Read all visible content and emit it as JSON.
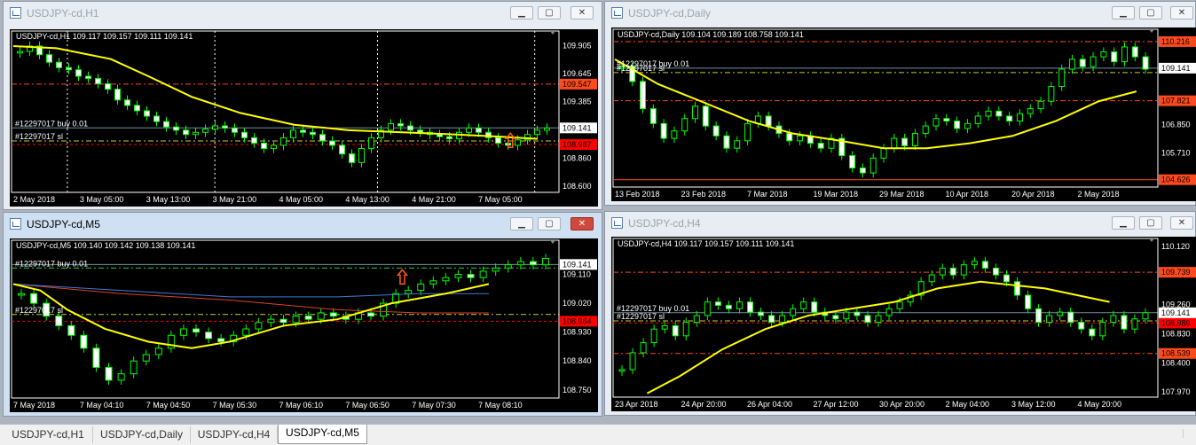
{
  "windows": [
    {
      "id": "h1",
      "active": false,
      "title": "USDJPY-cd,H1",
      "ohlc": "USDJPY-cd,H1  109.117 109.157 109.111 109.141",
      "price_min": 108.56,
      "price_max": 109.99,
      "price_labels": [
        "109.905",
        "109.645",
        "109.385",
        "109.141",
        "108.860",
        "108.600"
      ],
      "bid_label": "109.141",
      "bid": 109.141,
      "level_tags": [
        {
          "text": "109.547",
          "value": 109.547,
          "color": "#ff4a1c"
        },
        {
          "text": "108.987",
          "value": 108.987,
          "color": "#ff0000"
        }
      ],
      "hlines": [
        {
          "value": 109.547,
          "color": "#ff4a1c",
          "dash": "6,3,2,3"
        },
        {
          "value": 109.141,
          "color": "#6d8fa0",
          "dash": ""
        },
        {
          "value": 109.02,
          "color": "#cccc33",
          "dash": "6,3,2,3"
        },
        {
          "value": 108.987,
          "color": "#ff0000",
          "dash": "3,3"
        }
      ],
      "order_labels": [
        {
          "text": "#12297017 buy 0.01",
          "value": 109.141
        },
        {
          "text": "#12297017 sl",
          "value": 109.02
        }
      ],
      "time_labels": [
        "2 May 2018",
        "3 May 05:00",
        "3 May 13:00",
        "3 May 21:00",
        "4 May 05:00",
        "4 May 13:00",
        "4 May 21:00",
        "7 May 05:00"
      ],
      "day_separators": [
        0.1,
        0.373,
        0.674,
        0.965
      ],
      "arrow_index": 0.92,
      "ma": [
        [
          0,
          109.9
        ],
        [
          0.08,
          109.88
        ],
        [
          0.18,
          109.78
        ],
        [
          0.25,
          109.62
        ],
        [
          0.33,
          109.43
        ],
        [
          0.42,
          109.28
        ],
        [
          0.52,
          109.17
        ],
        [
          0.62,
          109.12
        ],
        [
          0.72,
          109.1
        ],
        [
          0.82,
          109.08
        ],
        [
          0.9,
          109.06
        ],
        [
          0.97,
          109.04
        ]
      ],
      "close_path": [
        109.85,
        109.9,
        109.82,
        109.75,
        109.7,
        109.68,
        109.62,
        109.6,
        109.55,
        109.5,
        109.4,
        109.35,
        109.3,
        109.25,
        109.2,
        109.15,
        109.12,
        109.08,
        109.1,
        109.13,
        109.16,
        109.14,
        109.1,
        109.05,
        109.0,
        108.95,
        108.98,
        109.05,
        109.12,
        109.1,
        109.08,
        109.02,
        108.98,
        108.9,
        108.82,
        108.95,
        109.05,
        109.12,
        109.18,
        109.16,
        109.12,
        109.1,
        109.08,
        109.06,
        109.04,
        109.1,
        109.14,
        109.1,
        109.05,
        109.0,
        108.98,
        109.03,
        109.08,
        109.12,
        109.14
      ]
    },
    {
      "id": "daily",
      "active": false,
      "title": "USDJPY-cd,Daily",
      "ohlc": "USDJPY-cd,Daily  109.104 109.189 108.758 109.141",
      "price_min": 104.4,
      "price_max": 110.5,
      "price_labels": [
        "110.216",
        "109.141",
        "107.821",
        "106.850",
        "105.710",
        "104.626"
      ],
      "bid_label": "109.141",
      "bid": 109.141,
      "level_tags": [
        {
          "text": "110.216",
          "value": 110.216,
          "color": "#ff4a1c"
        },
        {
          "text": "107.821",
          "value": 107.821,
          "color": "#ff4a1c"
        },
        {
          "text": "104.626",
          "value": 104.626,
          "color": "#ff4a1c"
        }
      ],
      "hlines": [
        {
          "value": 110.216,
          "color": "#ff4a1c",
          "dash": "6,3,2,3"
        },
        {
          "value": 109.141,
          "color": "#6d8fa0",
          "dash": ""
        },
        {
          "value": 108.96,
          "color": "#cccc33",
          "dash": "6,3,2,3"
        },
        {
          "value": 107.821,
          "color": "#ff4a1c",
          "dash": "6,3,2,3"
        },
        {
          "value": 104.626,
          "color": "#ff4a1c",
          "dash": ""
        }
      ],
      "order_labels": [
        {
          "text": "#12297017 buy 0.01",
          "value": 109.141
        },
        {
          "text": "#12297017 sl",
          "value": 108.96
        }
      ],
      "time_labels": [
        "13 Feb 2018",
        "23 Feb 2018",
        "7 Mar 2018",
        "19 Mar 2018",
        "29 Mar 2018",
        "10 Apr 2018",
        "20 Apr 2018",
        "2 May 2018"
      ],
      "day_separators": [],
      "arrow_index": -1,
      "ma": [
        [
          0,
          109.5
        ],
        [
          0.08,
          108.5
        ],
        [
          0.16,
          107.8
        ],
        [
          0.25,
          107.0
        ],
        [
          0.33,
          106.5
        ],
        [
          0.42,
          106.2
        ],
        [
          0.5,
          105.9
        ],
        [
          0.58,
          105.9
        ],
        [
          0.66,
          106.1
        ],
        [
          0.74,
          106.4
        ],
        [
          0.82,
          107.0
        ],
        [
          0.9,
          107.8
        ],
        [
          0.97,
          108.2
        ]
      ],
      "close_path": [
        109.2,
        108.6,
        107.5,
        106.9,
        106.3,
        106.6,
        107.1,
        107.6,
        106.8,
        106.4,
        105.9,
        106.2,
        106.9,
        107.2,
        106.8,
        106.5,
        106.2,
        106.4,
        106.1,
        105.9,
        106.3,
        105.6,
        105.1,
        104.9,
        105.5,
        105.9,
        106.3,
        106.0,
        106.5,
        106.8,
        107.1,
        107.0,
        106.7,
        106.9,
        107.2,
        107.4,
        107.2,
        107.0,
        107.3,
        107.5,
        107.8,
        108.4,
        109.1,
        109.5,
        109.2,
        109.6,
        109.8,
        109.4,
        110.0,
        109.6,
        109.1
      ]
    },
    {
      "id": "m5",
      "active": true,
      "title": "USDJPY-cd,M5",
      "ohlc": "USDJPY-cd,M5  109.140 109.142 109.138 109.141",
      "price_min": 108.73,
      "price_max": 109.2,
      "price_labels": [
        "109.141",
        "109.110",
        "109.020",
        "108.930",
        "108.840",
        "108.750"
      ],
      "bid_label": "109.141",
      "bid": 109.141,
      "level_tags": [
        {
          "text": "108.964",
          "value": 108.964,
          "color": "#ff0000"
        }
      ],
      "hlines": [
        {
          "value": 109.141,
          "color": "#6d8fa0",
          "dash": ""
        },
        {
          "value": 109.13,
          "color": "#33cc33",
          "dash": "6,3,2,3"
        },
        {
          "value": 108.985,
          "color": "#cccc33",
          "dash": "6,3,2,3"
        },
        {
          "value": 108.964,
          "color": "#ff0000",
          "dash": "3,3"
        }
      ],
      "order_labels": [
        {
          "text": "#12297017 buy 0.01",
          "value": 109.13
        },
        {
          "text": "#12297017 sl",
          "value": 108.985
        }
      ],
      "time_labels": [
        "7 May 2018",
        "7 May 04:10",
        "7 May 04:50",
        "7 May 05:30",
        "7 May 06:10",
        "7 May 06:50",
        "7 May 07:30",
        "7 May 08:10"
      ],
      "day_separators": [],
      "arrow_index": 0.72,
      "ma": [
        [
          0,
          109.08
        ],
        [
          0.05,
          109.06
        ],
        [
          0.1,
          109.0
        ],
        [
          0.17,
          108.94
        ],
        [
          0.25,
          108.9
        ],
        [
          0.33,
          108.88
        ],
        [
          0.4,
          108.9
        ],
        [
          0.5,
          108.95
        ],
        [
          0.6,
          108.97
        ],
        [
          0.7,
          109.02
        ],
        [
          0.8,
          109.05
        ],
        [
          0.88,
          109.08
        ]
      ],
      "ma2": [
        [
          0,
          109.08
        ],
        [
          0.2,
          109.06
        ],
        [
          0.4,
          109.04
        ],
        [
          0.6,
          109.04
        ],
        [
          0.75,
          109.05
        ],
        [
          0.88,
          109.05
        ]
      ],
      "ma3": [
        [
          0,
          109.08
        ],
        [
          0.2,
          109.05
        ],
        [
          0.4,
          109.03
        ],
        [
          0.6,
          109.0
        ],
        [
          0.75,
          108.99
        ],
        [
          0.88,
          108.99
        ]
      ],
      "close_path": [
        109.05,
        109.02,
        108.98,
        108.95,
        108.92,
        108.88,
        108.82,
        108.78,
        108.8,
        108.84,
        108.86,
        108.88,
        108.92,
        108.94,
        108.93,
        108.91,
        108.9,
        108.92,
        108.94,
        108.96,
        108.97,
        108.96,
        108.98,
        108.97,
        108.99,
        108.98,
        108.97,
        108.99,
        108.98,
        109.02,
        109.05,
        109.06,
        109.08,
        109.09,
        109.1,
        109.11,
        109.1,
        109.12,
        109.13,
        109.14,
        109.15,
        109.14,
        109.16
      ]
    },
    {
      "id": "h4",
      "active": false,
      "title": "USDJPY-cd,H4",
      "ohlc": "USDJPY-cd,H4  109.117 109.157 109.111 109.141",
      "price_min": 107.92,
      "price_max": 110.16,
      "price_labels": [
        "110.120",
        "109.739",
        "109.260",
        "109.141",
        "108.989",
        "108.830",
        "108.539",
        "108.400",
        "107.970"
      ],
      "bid_label": "109.141",
      "bid": 109.141,
      "level_tags": [
        {
          "text": "109.739",
          "value": 109.739,
          "color": "#ff4a1c"
        },
        {
          "text": "108.989",
          "value": 108.989,
          "color": "#ff0000"
        },
        {
          "text": "108.539",
          "value": 108.539,
          "color": "#ff4a1c"
        }
      ],
      "hlines": [
        {
          "value": 109.739,
          "color": "#ff4a1c",
          "dash": "6,3,2,3"
        },
        {
          "value": 109.141,
          "color": "#6d8fa0",
          "dash": ""
        },
        {
          "value": 109.02,
          "color": "#cccc33",
          "dash": "6,3,2,3"
        },
        {
          "value": 108.989,
          "color": "#ff0000",
          "dash": "3,3"
        },
        {
          "value": 108.539,
          "color": "#ff4a1c",
          "dash": "6,3,2,3"
        }
      ],
      "order_labels": [
        {
          "text": "#12297017 buy 0.01",
          "value": 109.141
        },
        {
          "text": "#12297017 sl",
          "value": 109.02
        }
      ],
      "time_labels": [
        "23 Apr 2018",
        "24 Apr 20:00",
        "26 Apr 04:00",
        "27 Apr 12:00",
        "30 Apr 20:00",
        "2 May 04:00",
        "3 May 12:00",
        "4 May 20:00"
      ],
      "day_separators": [],
      "arrow_index": -1,
      "ma": [
        [
          0.06,
          107.95
        ],
        [
          0.12,
          108.2
        ],
        [
          0.2,
          108.6
        ],
        [
          0.28,
          108.9
        ],
        [
          0.36,
          109.1
        ],
        [
          0.44,
          109.2
        ],
        [
          0.52,
          109.3
        ],
        [
          0.6,
          109.5
        ],
        [
          0.68,
          109.6
        ],
        [
          0.74,
          109.55
        ],
        [
          0.8,
          109.5
        ],
        [
          0.86,
          109.4
        ],
        [
          0.92,
          109.3
        ]
      ],
      "close_path": [
        108.3,
        108.55,
        108.7,
        108.9,
        108.95,
        108.8,
        109.0,
        109.1,
        109.3,
        109.25,
        109.2,
        109.3,
        109.15,
        109.1,
        109.0,
        109.1,
        109.2,
        109.3,
        109.15,
        109.1,
        109.05,
        109.15,
        109.1,
        109.0,
        109.1,
        109.2,
        109.3,
        109.4,
        109.6,
        109.7,
        109.8,
        109.7,
        109.85,
        109.9,
        109.8,
        109.7,
        109.6,
        109.4,
        109.2,
        109.0,
        109.1,
        109.15,
        109.0,
        108.9,
        108.8,
        109.0,
        109.1,
        108.9,
        109.05,
        109.14
      ]
    }
  ],
  "tabs": [
    {
      "label": "USDJPY-cd,H1",
      "selected": false
    },
    {
      "label": "USDJPY-cd,Daily",
      "selected": false
    },
    {
      "label": "USDJPY-cd,H4",
      "selected": false
    },
    {
      "label": "USDJPY-cd,M5",
      "selected": true
    }
  ],
  "colors": {
    "bull": "#00ff00",
    "bear": "#ffffff",
    "ma": "#ffff00",
    "ma2": "#3a7bd5",
    "ma3": "#e0402a",
    "axis_text": "#ffffff",
    "bid_tag": "#ffffff",
    "background": "#000000"
  }
}
